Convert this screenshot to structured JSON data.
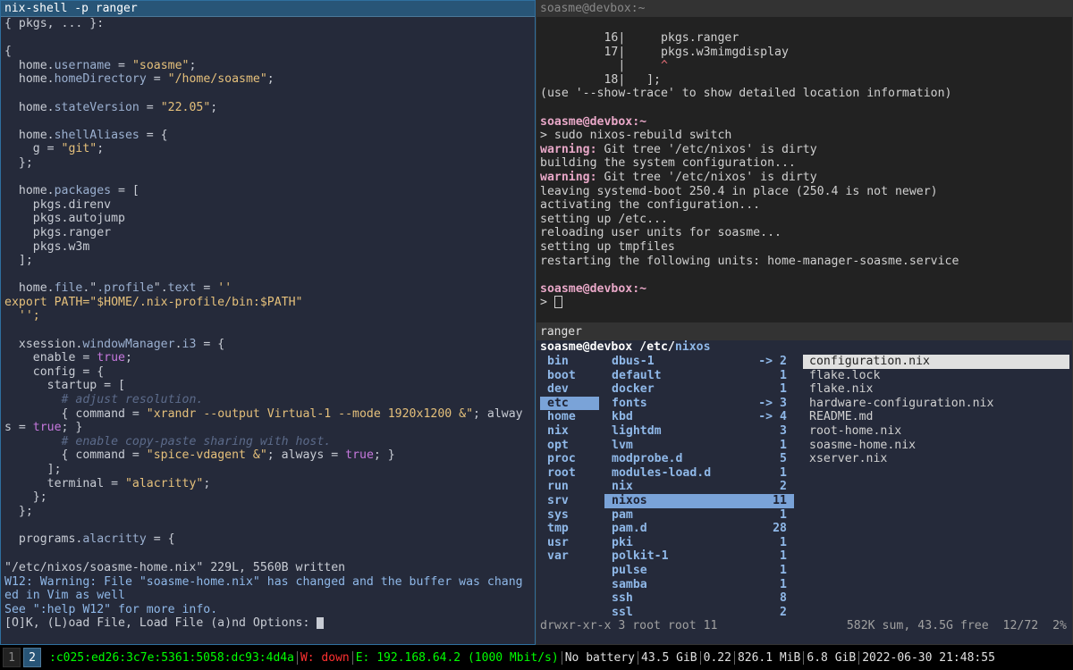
{
  "left": {
    "title": "nix-shell -p ranger",
    "code": [
      [
        {
          "t": "{ pkgs, ... }:"
        }
      ],
      [],
      [
        {
          "t": "{"
        }
      ],
      [
        {
          "t": "  home."
        },
        {
          "t": "username",
          "c": "n"
        },
        {
          "t": " = "
        },
        {
          "t": "\"soasme\"",
          "c": "s"
        },
        {
          "t": ";"
        }
      ],
      [
        {
          "t": "  home."
        },
        {
          "t": "homeDirectory",
          "c": "n"
        },
        {
          "t": " = "
        },
        {
          "t": "\"/home/soasme\"",
          "c": "s"
        },
        {
          "t": ";"
        }
      ],
      [],
      [
        {
          "t": "  home."
        },
        {
          "t": "stateVersion",
          "c": "n"
        },
        {
          "t": " = "
        },
        {
          "t": "\"22.05\"",
          "c": "s"
        },
        {
          "t": ";"
        }
      ],
      [],
      [
        {
          "t": "  home."
        },
        {
          "t": "shellAliases",
          "c": "n"
        },
        {
          "t": " = {"
        }
      ],
      [
        {
          "t": "    g = "
        },
        {
          "t": "\"git\"",
          "c": "s"
        },
        {
          "t": ";"
        }
      ],
      [
        {
          "t": "  };"
        }
      ],
      [],
      [
        {
          "t": "  home."
        },
        {
          "t": "packages",
          "c": "n"
        },
        {
          "t": " = ["
        }
      ],
      [
        {
          "t": "    pkgs.direnv"
        }
      ],
      [
        {
          "t": "    pkgs.autojump"
        }
      ],
      [
        {
          "t": "    pkgs.ranger"
        }
      ],
      [
        {
          "t": "    pkgs.w3m"
        }
      ],
      [
        {
          "t": "  ];"
        }
      ],
      [],
      [
        {
          "t": "  home."
        },
        {
          "t": "file",
          "c": "n"
        },
        {
          "t": ".\""
        },
        {
          "t": ".profile",
          "c": "n"
        },
        {
          "t": "\"."
        },
        {
          "t": "text",
          "c": "n"
        },
        {
          "t": " = "
        },
        {
          "t": "''",
          "c": "s"
        }
      ],
      [
        {
          "t": "export PATH=\"$HOME/.nix-profile/bin:$PATH\"",
          "c": "s"
        }
      ],
      [
        {
          "t": "  '';",
          "c": "s"
        }
      ],
      [],
      [
        {
          "t": "  xsession."
        },
        {
          "t": "windowManager",
          "c": "n"
        },
        {
          "t": "."
        },
        {
          "t": "i3",
          "c": "n"
        },
        {
          "t": " = {"
        }
      ],
      [
        {
          "t": "    enable = "
        },
        {
          "t": "true",
          "c": "kw"
        },
        {
          "t": ";"
        }
      ],
      [
        {
          "t": "    config = {"
        }
      ],
      [
        {
          "t": "      startup = ["
        }
      ],
      [
        {
          "t": "        "
        },
        {
          "t": "# adjust resolution.",
          "c": "cm"
        }
      ],
      [
        {
          "t": "        { command = "
        },
        {
          "t": "\"xrandr --output Virtual-1 --mode 1920x1200 &\"",
          "c": "s"
        },
        {
          "t": "; alway"
        }
      ],
      [
        {
          "t": "s = "
        },
        {
          "t": "true",
          "c": "kw"
        },
        {
          "t": "; }"
        }
      ],
      [
        {
          "t": "        "
        },
        {
          "t": "# enable copy-paste sharing with host.",
          "c": "cm"
        }
      ],
      [
        {
          "t": "        { command = "
        },
        {
          "t": "\"spice-vdagent &\"",
          "c": "s"
        },
        {
          "t": "; always = "
        },
        {
          "t": "true",
          "c": "kw"
        },
        {
          "t": "; }"
        }
      ],
      [
        {
          "t": "      ];"
        }
      ],
      [
        {
          "t": "      terminal = "
        },
        {
          "t": "\"alacritty\"",
          "c": "s"
        },
        {
          "t": ";"
        }
      ],
      [
        {
          "t": "    };"
        }
      ],
      [
        {
          "t": "  };"
        }
      ],
      [],
      [
        {
          "t": "  programs."
        },
        {
          "t": "alacritty",
          "c": "n"
        },
        {
          "t": " = {"
        }
      ]
    ],
    "msg": {
      "line1": "\"/etc/nixos/soasme-home.nix\" 229L, 5560B written",
      "line2": "W12: Warning: File \"soasme-home.nix\" has changed and the buffer was chang",
      "line3": "ed in Vim as well",
      "line4": "See \":help W12\" for more info.",
      "line5": "[O]K, (L)oad File, Load File (a)nd Options: "
    }
  },
  "shell": {
    "title": "soasme@devbox:~",
    "lines": [
      [
        {
          "t": "         16|     pkgs.ranger"
        }
      ],
      [
        {
          "t": "         17|     pkgs.w3mimgdisplay"
        }
      ],
      [
        {
          "t": "           |     "
        },
        {
          "t": "^",
          "c": "red"
        }
      ],
      [
        {
          "t": "         18|   ];"
        }
      ],
      [
        {
          "t": "(use '--show-trace' to show detailed location information)"
        }
      ],
      [],
      [
        {
          "t": "soasme@devbox:~",
          "c": "pr"
        }
      ],
      [
        {
          "t": "> sudo nixos-rebuild switch"
        }
      ],
      [
        {
          "t": "warning:",
          "c": "wn"
        },
        {
          "t": " Git tree '/etc/nixos' is dirty"
        }
      ],
      [
        {
          "t": "building the system configuration..."
        }
      ],
      [
        {
          "t": "warning:",
          "c": "wn"
        },
        {
          "t": " Git tree '/etc/nixos' is dirty"
        }
      ],
      [
        {
          "t": "leaving systemd-boot 250.4 in place (250.4 is not newer)"
        }
      ],
      [
        {
          "t": "activating the configuration..."
        }
      ],
      [
        {
          "t": "setting up /etc..."
        }
      ],
      [
        {
          "t": "reloading user units for soasme..."
        }
      ],
      [
        {
          "t": "setting up tmpfiles"
        }
      ],
      [
        {
          "t": "restarting the following units: home-manager-soasme.service"
        }
      ],
      [],
      [
        {
          "t": "soasme@devbox:~",
          "c": "pr"
        }
      ]
    ],
    "prompt_symbol": "> "
  },
  "ranger": {
    "title": "ranger",
    "path_user": "soasme@devbox",
    "path_dir": " /etc/",
    "path_cur": "nixos",
    "col1": [
      "bin",
      "boot",
      "dev",
      "etc",
      "home",
      "nix",
      "opt",
      "proc",
      "root",
      "run",
      "srv",
      "sys",
      "tmp",
      "usr",
      "var"
    ],
    "col1_selected": 3,
    "col2": [
      {
        "name": "dbus-1",
        "count": "-> 2"
      },
      {
        "name": "default",
        "count": "1"
      },
      {
        "name": "docker",
        "count": "1"
      },
      {
        "name": "fonts",
        "count": "-> 3"
      },
      {
        "name": "kbd",
        "count": "-> 4"
      },
      {
        "name": "lightdm",
        "count": "3"
      },
      {
        "name": "lvm",
        "count": "1"
      },
      {
        "name": "modprobe.d",
        "count": "5"
      },
      {
        "name": "modules-load.d",
        "count": "1"
      },
      {
        "name": "nix",
        "count": "2"
      },
      {
        "name": "nixos",
        "count": "11"
      },
      {
        "name": "pam",
        "count": "1"
      },
      {
        "name": "pam.d",
        "count": "28"
      },
      {
        "name": "pki",
        "count": "1"
      },
      {
        "name": "polkit-1",
        "count": "1"
      },
      {
        "name": "pulse",
        "count": "1"
      },
      {
        "name": "samba",
        "count": "1"
      },
      {
        "name": "ssh",
        "count": "8"
      },
      {
        "name": "ssl",
        "count": "2"
      }
    ],
    "col2_selected": 10,
    "col3": [
      "configuration.nix",
      "flake.lock",
      "flake.nix",
      "hardware-configuration.nix",
      "README.md",
      "root-home.nix",
      "soasme-home.nix",
      "xserver.nix"
    ],
    "col3_selected": 0,
    "status_left": "drwxr-xr-x 3 root root 11",
    "status_right": "582K sum, 43.5G free  12/72  2%"
  },
  "bar": {
    "ws1": "1",
    "ws2": "2",
    "ipv6": ":c025:ed26:3c7e:5361:5058:dc93:4d4a",
    "wifi": "W: down",
    "eth": "E: 192.168.64.2 (1000 Mbit/s)",
    "battery": "No battery",
    "disk": "43.5 GiB",
    "load": "0.22",
    "mem": "826.1 MiB",
    "swap": "6.8 GiB",
    "datetime": "2022-06-30 21:48:55"
  }
}
